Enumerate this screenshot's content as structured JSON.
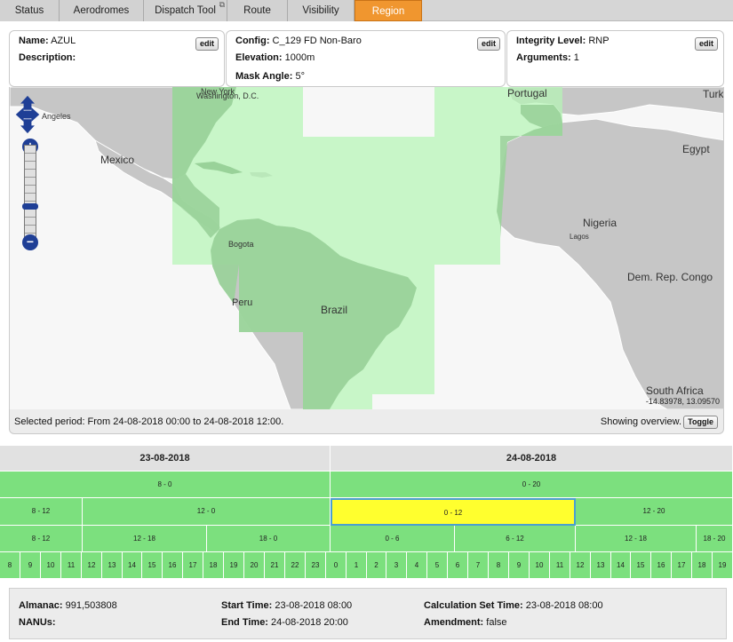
{
  "tabs": [
    {
      "label": "Status"
    },
    {
      "label": "Aerodromes"
    },
    {
      "label": "Dispatch Tool"
    },
    {
      "label": "Route"
    },
    {
      "label": "Visibility"
    },
    {
      "label": "Region"
    }
  ],
  "tabs_active": "Region",
  "panel1": {
    "name_label": "Name:",
    "name_value": "AZUL",
    "desc_label": "Description:",
    "edit": "edit"
  },
  "panel2": {
    "config_label": "Config:",
    "config_value": "C_129 FD Non-Baro",
    "elev_label": "Elevation:",
    "elev_value": "1000m",
    "mask_label": "Mask Angle:",
    "mask_value": "5°",
    "edit": "edit"
  },
  "panel3": {
    "integ_label": "Integrity Level:",
    "integ_value": "RNP",
    "args_label": "Arguments:",
    "args_value": "1",
    "edit": "edit"
  },
  "map": {
    "labels": {
      "washington": "Washington, D.C.",
      "newyork": "New York",
      "angeles": "Angeles",
      "mexico": "Mexico",
      "portugal": "Portugal",
      "turkey": "Turk",
      "egypt": "Egypt",
      "nigeria": "Nigeria",
      "lagos": "Lagos",
      "bogota": "Bogota",
      "peru": "Peru",
      "brazil": "Brazil",
      "drc": "Dem. Rep. Congo",
      "southafrica": "South Africa"
    },
    "coords": "-14.83978, 13.09570",
    "colors": {
      "land": "#c6c6c6",
      "region": "#c8f7c8",
      "region_land": "#9fd59f",
      "border": "#ffffff"
    }
  },
  "status": {
    "selected": "Selected period: From 24-08-2018 00:00 to 24-08-2018 12:00.",
    "overview": "Showing overview.",
    "toggle": "Toggle"
  },
  "timeline": {
    "dates": [
      "23-08-2018",
      "24-08-2018"
    ],
    "row1": [
      "8 - 0",
      "0 - 20"
    ],
    "row2": [
      "8 - 12",
      "12 - 0",
      "0 - 12",
      "12 - 20"
    ],
    "row3": [
      "8 - 12",
      "12 - 18",
      "18 - 0",
      "0 - 6",
      "6 - 12",
      "12 - 18",
      "18 - 20"
    ],
    "hours": [
      "8",
      "9",
      "10",
      "11",
      "12",
      "13",
      "14",
      "15",
      "16",
      "17",
      "18",
      "19",
      "20",
      "21",
      "22",
      "23",
      "0",
      "1",
      "2",
      "3",
      "4",
      "5",
      "6",
      "7",
      "8",
      "9",
      "10",
      "11",
      "12",
      "13",
      "14",
      "15",
      "16",
      "17",
      "18",
      "19"
    ],
    "selected": "0 - 12"
  },
  "footer": {
    "almanac_label": "Almanac:",
    "almanac_value": "991,503808",
    "nanus_label": "NANUs:",
    "start_label": "Start Time:",
    "start_value": "23-08-2018 08:00",
    "end_label": "End Time:",
    "end_value": "24-08-2018 20:00",
    "calc_label": "Calculation Set Time:",
    "calc_value": "23-08-2018 08:00",
    "amend_label": "Amendment:",
    "amend_value": "false"
  }
}
